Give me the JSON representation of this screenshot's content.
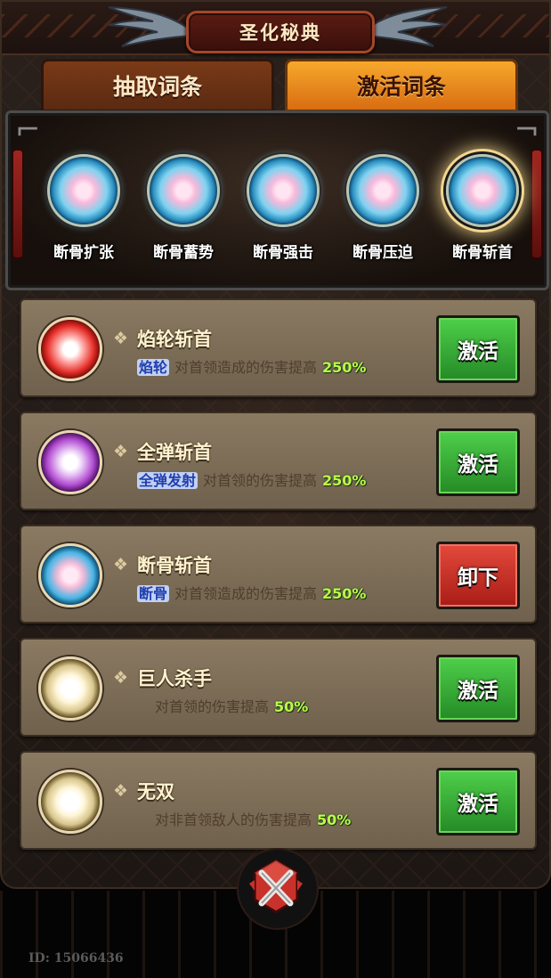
{
  "header": {
    "title": "圣化秘典"
  },
  "tabs": [
    {
      "label": "抽取词条",
      "active": false
    },
    {
      "label": "激活词条",
      "active": true
    }
  ],
  "slots": [
    {
      "label": "断骨扩张",
      "active": false
    },
    {
      "label": "断骨蓄势",
      "active": false
    },
    {
      "label": "断骨强击",
      "active": false
    },
    {
      "label": "断骨压迫",
      "active": false
    },
    {
      "label": "断骨斩首",
      "active": true
    }
  ],
  "cards": [
    {
      "title": "焰轮斩首",
      "tag": "焰轮",
      "desc": "对首领造成的伤害提高",
      "value": "250%",
      "button": "激活",
      "button_color": "green",
      "orb_color": "#e8302a"
    },
    {
      "title": "全弹斩首",
      "tag": "全弹发射",
      "desc": "对首领的伤害提高",
      "value": "250%",
      "button": "激活",
      "button_color": "green",
      "orb_color": "#b04ad0"
    },
    {
      "title": "断骨斩首",
      "tag": "断骨",
      "desc": "对首领造成的伤害提高",
      "value": "250%",
      "button": "卸下",
      "button_color": "red",
      "orb_color": "#46b6e6"
    },
    {
      "title": "巨人杀手",
      "tag": "",
      "desc": "对首领的伤害提高",
      "value": "50%",
      "button": "激活",
      "button_color": "green",
      "orb_color": "#d8c68c"
    },
    {
      "title": "无双",
      "tag": "",
      "desc": "对非首领敌人的伤害提高",
      "value": "50%",
      "button": "激活",
      "button_color": "green",
      "orb_color": "#d8c68c"
    }
  ],
  "footer": {
    "user_id": "ID: 15066436"
  },
  "colors": {
    "accent_orange": "#f7a82c",
    "button_green": "#3aae36",
    "button_red": "#c42a20",
    "percent_green": "#b6ff4a"
  }
}
